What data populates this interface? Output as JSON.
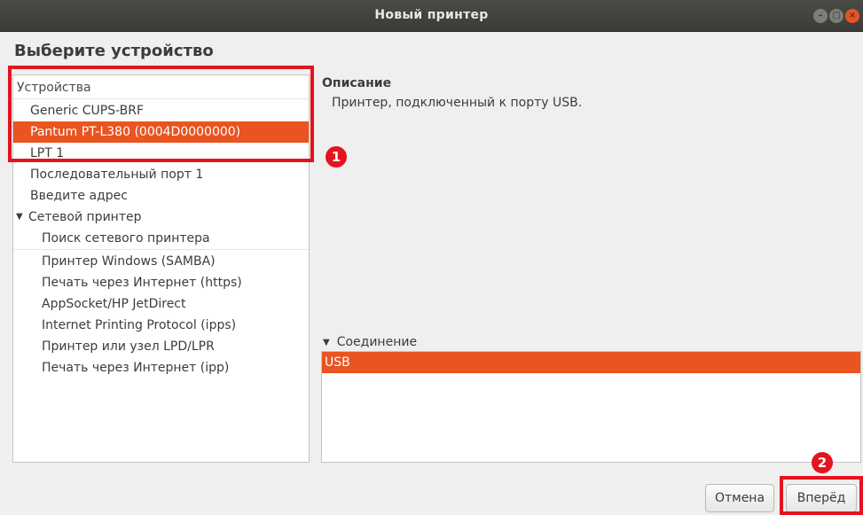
{
  "window": {
    "title": "Новый принтер",
    "controls": {
      "minimize": "minimize-icon",
      "maximize": "maximize-icon",
      "close": "close-icon"
    }
  },
  "heading": "Выберите устройство",
  "devices": {
    "header": "Устройства",
    "items": [
      {
        "label": "Generic CUPS-BRF",
        "selected": false
      },
      {
        "label": "Pantum PT-L380 (0004D0000000)",
        "selected": true
      },
      {
        "label": "LPT 1",
        "selected": false
      },
      {
        "label": "Последовательный порт 1",
        "selected": false
      },
      {
        "label": "Введите адрес",
        "selected": false
      }
    ],
    "network_group": {
      "label": "Сетевой принтер",
      "expanded": true,
      "items": [
        "Поиск сетевого принтера",
        "Принтер Windows (SAMBA)",
        "Печать через Интернет (https)",
        "AppSocket/HP JetDirect",
        "Internet Printing Protocol (ipps)",
        "Принтер или узел LPD/LPR",
        "Печать через Интернет (ipp)"
      ]
    }
  },
  "description": {
    "title": "Описание",
    "text": "Принтер, подключенный к порту USB."
  },
  "connection": {
    "label": "Соединение",
    "expanded": true,
    "items": [
      {
        "label": "USB",
        "selected": true
      }
    ]
  },
  "buttons": {
    "cancel": "Отмена",
    "forward": "Вперёд"
  },
  "annotations": {
    "badge_one": "1",
    "badge_two": "2",
    "color": "#e3141e"
  },
  "colors": {
    "accent": "#e95420",
    "titlebar": "#3b3b38"
  }
}
